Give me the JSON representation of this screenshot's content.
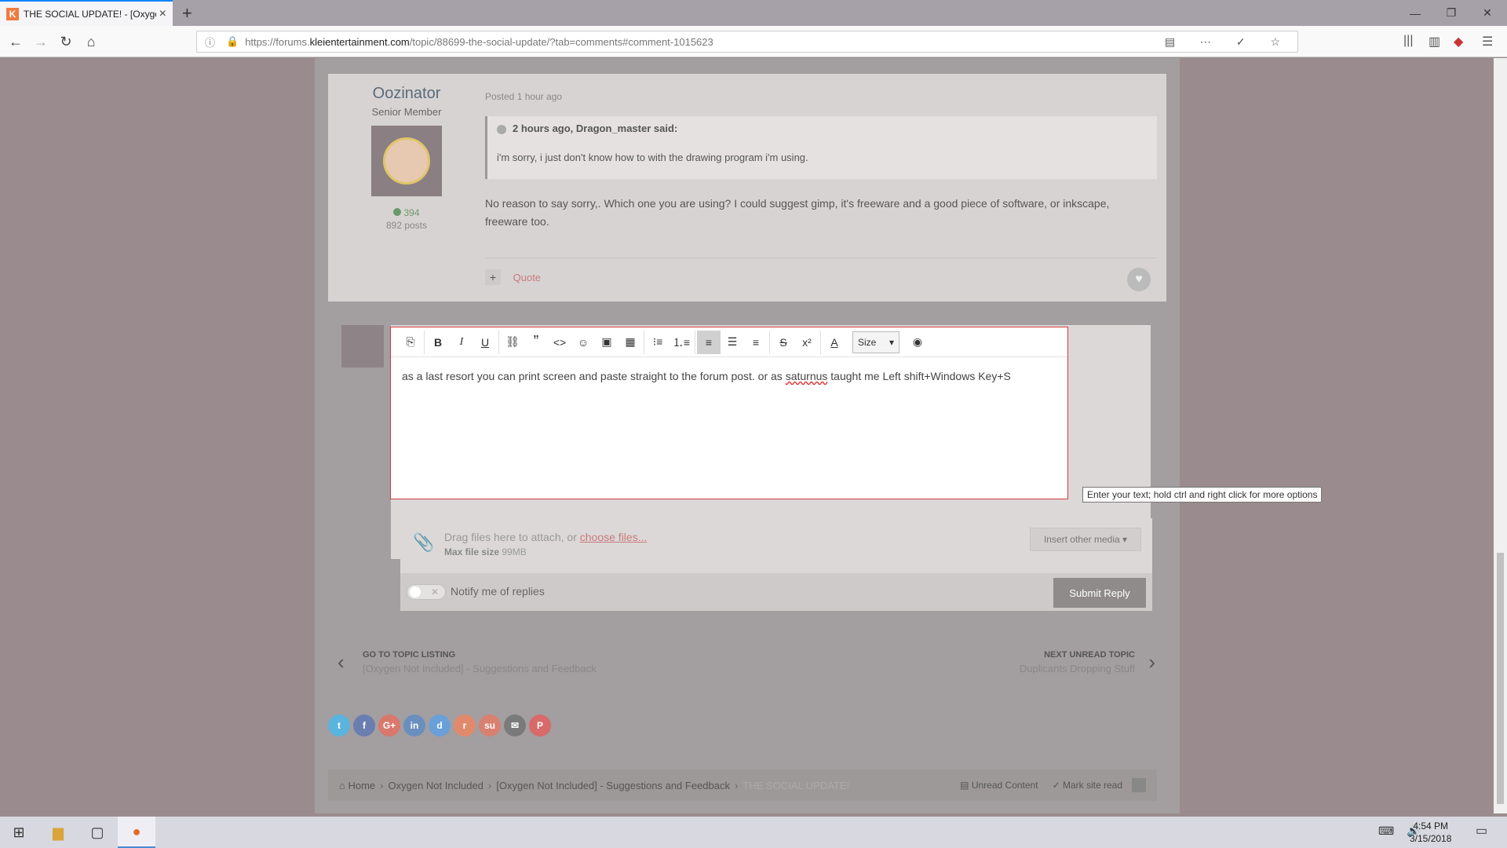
{
  "browser": {
    "tab_title": "THE SOCIAL UPDATE! - [Oxyge",
    "url_prefix": "https://forums.",
    "url_domain": "kleientertainment.com",
    "url_path": "/topic/88699-the-social-update/?tab=comments#comment-1015623"
  },
  "post": {
    "author": "Oozinator",
    "author_title": "Senior Member",
    "reputation": "394",
    "post_count": "892 posts",
    "posted": "Posted 1 hour ago",
    "quote_cite": "2 hours ago, Dragon_master said:",
    "quote_text": "i'm sorry, i just don't know how to with the drawing program i'm using.",
    "body": "No reason to say sorry,. Which one you are using? I could suggest gimp, it's freeware and a good piece of software, or inkscape, freeware too.",
    "quote_label": "Quote"
  },
  "editor": {
    "size_label": "Size",
    "text_before": "as a last resort you can print screen and paste straight to the forum post. or as ",
    "text_typo": "saturnus",
    "text_after": " taught me Left shift+Windows Key+S",
    "tooltip": "Enter your text; hold ctrl and right click for more options"
  },
  "attach": {
    "drag_text": "Drag files here to attach, or ",
    "choose_link": "choose files...",
    "max_label": "Max file size",
    "max_value": "99MB",
    "insert_media": "Insert other media ▾"
  },
  "reply": {
    "notify": "Notify me of replies",
    "submit": "Submit Reply"
  },
  "topic_nav": {
    "left_label": "GO TO TOPIC LISTING",
    "left_sub": "[Oxygen Not Included] - Suggestions and Feedback",
    "right_label": "NEXT UNREAD TOPIC",
    "right_sub": "Duplicants Dropping Stuff"
  },
  "breadcrumb": {
    "items": [
      "Home",
      "Oxygen Not Included",
      "[Oxygen Not Included] - Suggestions and Feedback"
    ],
    "current": "THE SOCIAL UPDATE!",
    "unread": "Unread Content",
    "mark_read": "Mark site read"
  },
  "share_colors": [
    "#5ab4dd",
    "#6a7fb0",
    "#d9786b",
    "#6a8fbf",
    "#6aa0d8",
    "#e08a6b",
    "#d98070",
    "#7a7a7a",
    "#d86a6a"
  ],
  "share_icons": [
    "twitter-icon",
    "facebook-icon",
    "google-plus-icon",
    "linkedin-icon",
    "delicious-icon",
    "reddit-icon",
    "stumbleupon-icon",
    "email-icon",
    "pinterest-icon"
  ],
  "clock": {
    "time": "4:54 PM",
    "date": "3/15/2018"
  }
}
